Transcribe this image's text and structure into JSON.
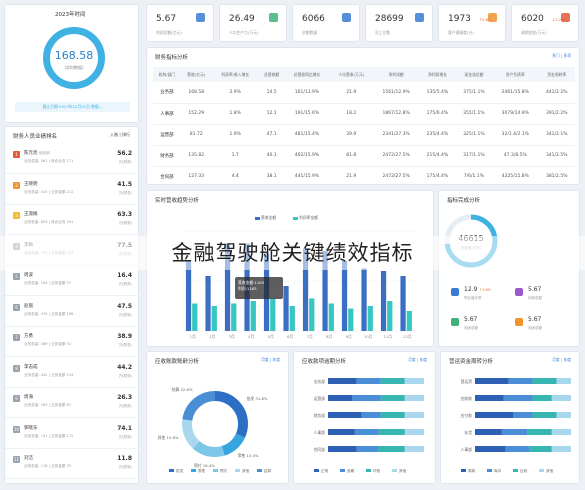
{
  "left_top": {
    "title": "2023年时间",
    "value": "168.58",
    "unit": "(实时数据)",
    "note": "截止日期:2023年12月31日 数据..."
  },
  "rank": {
    "title": "财务人员业绩排名",
    "tabs": [
      "入账",
      "排行"
    ],
    "items": [
      {
        "rank": "1",
        "name": "陈元亮",
        "role": "综合部",
        "sub": "业务总量: 561 | 综合业务 171",
        "value": "56.2",
        "unit": "万(财务)",
        "color": "#e05a3b"
      },
      {
        "rank": "2",
        "name": "王晓明",
        "role": "",
        "sub": "业务总量: 415 | 业务金额 212",
        "value": "41.5",
        "unit": "万(财务)",
        "color": "#f0922e"
      },
      {
        "rank": "3",
        "name": "王淑娟",
        "role": "",
        "sub": "业务总量: 633 | 综合业务 201",
        "value": "63.3",
        "unit": "万(财务)",
        "color": "#f5b82e"
      },
      {
        "rank": "4",
        "name": "李梅",
        "role": "",
        "sub": "业务总量: 775 | 业务金额 141",
        "value": "77.5",
        "unit": "万(财务)",
        "color": "#9aa3ad"
      },
      {
        "rank": "5",
        "name": "周波",
        "role": "",
        "sub": "业务总量: 164 | 业务金额 57",
        "value": "16.4",
        "unit": "万(财务)",
        "color": "#9aa3ad"
      },
      {
        "rank": "6",
        "name": "赵丽",
        "role": "",
        "sub": "业务总量: 475 | 业务金额 168",
        "value": "47.5",
        "unit": "万(财务)",
        "color": "#9aa3ad"
      },
      {
        "rank": "7",
        "name": "方勇",
        "role": "",
        "sub": "业务总量: 389 | 业务金额 92",
        "value": "38.9",
        "unit": "万(财务)",
        "color": "#9aa3ad"
      },
      {
        "rank": "8",
        "name": "李志成",
        "role": "",
        "sub": "业务总量: 442 | 业务金额 134",
        "value": "44.2",
        "unit": "万(财务)",
        "color": "#9aa3ad"
      },
      {
        "rank": "9",
        "name": "周海",
        "role": "",
        "sub": "业务总量: 263 | 业务金额 81",
        "value": "26.3",
        "unit": "万(财务)",
        "color": "#9aa3ad"
      },
      {
        "rank": "10",
        "name": "郭晓东",
        "role": "",
        "sub": "业务总量: 741 | 业务金额 172",
        "value": "74.1",
        "unit": "万(财务)",
        "color": "#9aa3ad"
      },
      {
        "rank": "11",
        "name": "刘洁",
        "role": "",
        "sub": "业务总量: 118 | 业务金额 33",
        "value": "11.8",
        "unit": "万(财务)",
        "color": "#9aa3ad"
      }
    ]
  },
  "kpis": [
    {
      "value": "5.67",
      "label": "利润总额(亿元)",
      "change": "",
      "color": "#3a7bd5"
    },
    {
      "value": "26.49",
      "label": "人均生产力(万元)",
      "change": "",
      "color": "#3fb17a"
    },
    {
      "value": "6066",
      "label": "总额数量",
      "change": "",
      "color": "#3a7bd5"
    },
    {
      "value": "28699",
      "label": "员工总数",
      "change": "",
      "color": "#3a7bd5"
    },
    {
      "value": "1973",
      "label": "客户满意度(分)",
      "change": "↑0.6%",
      "color": "#f0922e"
    },
    {
      "value": "6020",
      "label": "逾期应收(万元)",
      "change": "↓3.2%",
      "color": "#e05a3b"
    }
  ],
  "table": {
    "title": "财务指标分析",
    "more": "多门 | 多项",
    "headers": [
      "机构/部门",
      "营收(亿元)",
      "利润率/收入增长",
      "总营收额",
      "总营收同比增长",
      "人均营收(万元)",
      "净利润额",
      "净利润增长",
      "现金流总额",
      "资产负债率",
      "资金周转率"
    ],
    "rows": [
      [
        "业务部",
        "168.58",
        "2.9%",
        "14.5",
        "161/13.9%",
        "21.9",
        "1561/12.9%",
        "135/5.4%",
        "375/1.1%",
        "2461/15.8%",
        "441/2.2%"
      ],
      [
        "人事部",
        "152.29",
        "1.8%",
        "12.1",
        "191/15.6%",
        "18.2",
        "1867/12.8%",
        "175/6.4%",
        "355/1.1%",
        "3079/14.9%",
        "391/2.2%"
      ],
      [
        "运营部",
        "81.72",
        "1.9%",
        "47.1",
        "481/15.4%",
        "39.9",
        "2341/27.3%",
        "235/4.4%",
        "325/1.1%",
        "32/1.4/2.1%",
        "341/2.1%"
      ],
      [
        "财务部",
        "135.82",
        "1.7",
        "40.1",
        "462/15.9%",
        "81.8",
        "2472/27.5%",
        "215/4.4%",
        "317/1.1%",
        "47.3/8.5%",
        "341/2.5%"
      ],
      [
        "合同部",
        "127.33",
        "4.4",
        "38.1",
        "441/15.9%",
        "21.9",
        "2472/27.5%",
        "175/4.4%",
        "7/6/1.1%",
        "4325/15.8%",
        "381/2.5%"
      ]
    ]
  },
  "bar_chart": {
    "title": "实时营收趋势分析",
    "legend": [
      "营收金额",
      "利润率金额"
    ],
    "tooltip": "营收金额:1163\n利润:1163",
    "colors": [
      "#3a6fc4",
      "#37c6c0"
    ]
  },
  "chart_data": [
    {
      "type": "bar",
      "title": "实时营收趋势分析",
      "categories": [
        "1月",
        "2月",
        "3月",
        "4月",
        "5月",
        "6月",
        "7月",
        "8月",
        "9月",
        "10月",
        "11月",
        "12月"
      ],
      "series": [
        {
          "name": "营收金额",
          "values": [
            140,
            110,
            175,
            175,
            155,
            90,
            165,
            160,
            140,
            125,
            120,
            110
          ]
        },
        {
          "name": "利润率金额",
          "values": [
            55,
            50,
            55,
            60,
            65,
            50,
            65,
            55,
            45,
            50,
            60,
            40
          ]
        }
      ],
      "ylim": [
        0,
        200
      ]
    },
    {
      "type": "pie",
      "title": "应收账款账龄分析",
      "categories": [
        "批发",
        "零售",
        "预付",
        "其他",
        "结算"
      ],
      "values": [
        31.8,
        13.4,
        16.4,
        15.6,
        22.8
      ],
      "labels": [
        "31.8%",
        "13.4%",
        "16.4%",
        "15.6%",
        "22.8%"
      ]
    },
    {
      "type": "bar",
      "title": "应收款项逾期分析",
      "categories": [
        "业务部",
        "运营部",
        "财务部",
        "人事部",
        "合同部"
      ],
      "series": [
        {
          "name": "正常",
          "values": [
            30,
            25,
            35,
            28,
            30
          ]
        },
        {
          "name": "逾期",
          "values": [
            25,
            30,
            20,
            25,
            22
          ]
        },
        {
          "name": "坏账",
          "values": [
            25,
            25,
            25,
            27,
            28
          ]
        },
        {
          "name": "其他",
          "values": [
            20,
            20,
            20,
            20,
            20
          ]
        }
      ]
    },
    {
      "type": "bar",
      "title": "营运资金周转分析",
      "categories": [
        "营运资",
        "应收款",
        "应付款",
        "存货",
        "人事部"
      ],
      "series": [
        {
          "name": "周转",
          "values": [
            35,
            30,
            40,
            28,
            32
          ]
        },
        {
          "name": "库存",
          "values": [
            25,
            30,
            20,
            27,
            25
          ]
        },
        {
          "name": "应收",
          "values": [
            25,
            20,
            25,
            25,
            23
          ]
        },
        {
          "name": "其他",
          "values": [
            15,
            20,
            15,
            20,
            20
          ]
        }
      ]
    }
  ],
  "ring_panel": {
    "title": "指标完成分析",
    "center_value": "46615",
    "center_label": "总营收(万元)",
    "stats": [
      {
        "value": "12.9",
        "label": "同比增长率",
        "change": "↑2.6%",
        "color": "#3a7bd5"
      },
      {
        "value": "5.67",
        "label": "利润总额",
        "change": "",
        "color": "#9b59d0"
      },
      {
        "value": "5.67",
        "label": "利润总额",
        "change": "",
        "color": "#3fb17a"
      },
      {
        "value": "5.67",
        "label": "利润总额",
        "change": "",
        "color": "#f0922e"
      }
    ]
  },
  "donut": {
    "title": "应收账款账龄分析",
    "tabs": "月度 | 年度"
  },
  "hbar1": {
    "title": "应收款项逾期分析",
    "tabs": "月度 | 年度"
  },
  "hbar2": {
    "title": "营运资金周转分析",
    "tabs": "月度 | 年度"
  },
  "overlay_title": "金融驾驶舱关键绩效指标"
}
